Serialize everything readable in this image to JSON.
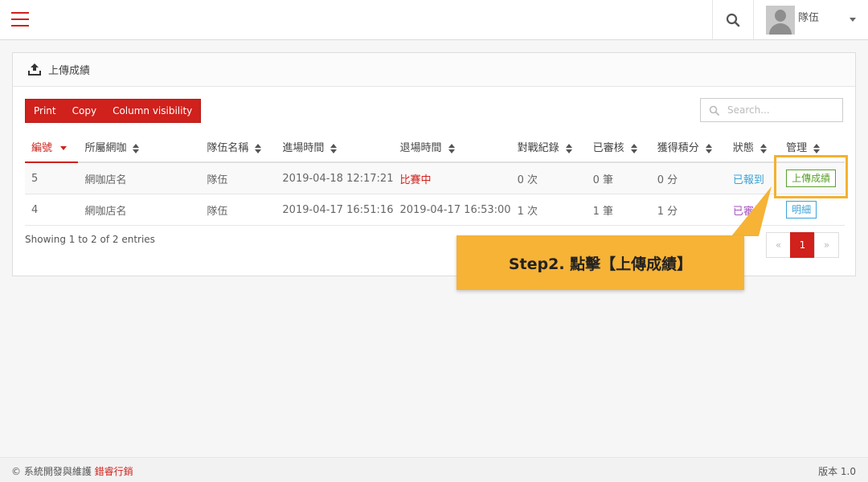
{
  "header": {
    "user_name": "隊伍"
  },
  "panel": {
    "title": "上傳成績"
  },
  "toolbar": {
    "buttons": [
      "Print",
      "Copy",
      "Column visibility"
    ],
    "search_placeholder": "Search..."
  },
  "table": {
    "columns": [
      "編號",
      "所屬網咖",
      "隊伍名稱",
      "進場時間",
      "退場時間",
      "對戰紀錄",
      "已審核",
      "獲得積分",
      "狀態",
      "管理"
    ],
    "rows": [
      {
        "id": "5",
        "cafe": "網咖店名",
        "team": "隊伍",
        "enter_time": "2019-04-18 12:17:21",
        "exit_time": "比賽中",
        "record": "0 次",
        "reviewed": "0 筆",
        "points": "0 分",
        "status": "已報到",
        "action": "上傳成績"
      },
      {
        "id": "4",
        "cafe": "網咖店名",
        "team": "隊伍",
        "enter_time": "2019-04-17 16:51:16",
        "exit_time": "2019-04-17 16:53:00",
        "record": "1 次",
        "reviewed": "1 筆",
        "points": "1 分",
        "status": "已審核",
        "action": "明細"
      }
    ]
  },
  "info": {
    "entries": "Showing 1 to 2 of 2 entries"
  },
  "pagination": {
    "prev": "«",
    "current": "1",
    "next": "»"
  },
  "callout": {
    "text": "Step2. 點擊【上傳成績】"
  },
  "footer": {
    "copyright": "© 系統開發與維護",
    "brand": "錯睿行銷",
    "version": "版本 1.0"
  },
  "colors": {
    "accent": "#d0211c",
    "callout": "#f6b336",
    "status_checked_in": "#3aa3d8",
    "status_reviewed": "#a653c1",
    "upload_button": "#5aa02c"
  },
  "icons": {
    "menu": "hamburger-icon",
    "search": "search-icon",
    "upload": "upload-icon",
    "dropdown": "caret-down-icon"
  }
}
